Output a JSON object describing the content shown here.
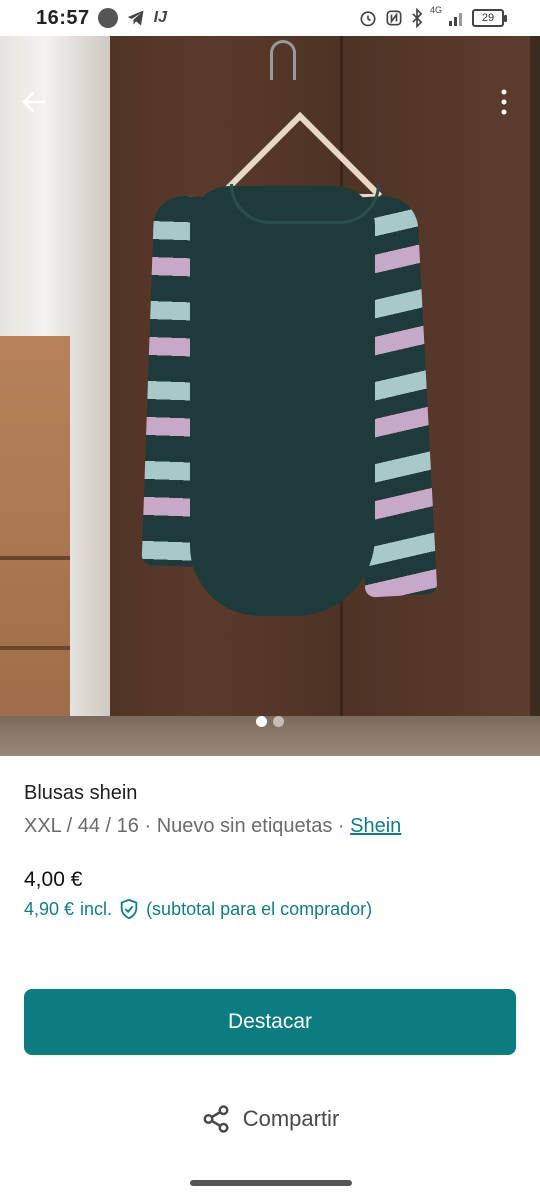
{
  "status_bar": {
    "time": "16:57",
    "network_label": "4G",
    "battery_level": "29"
  },
  "photo": {
    "current_index": 1,
    "total": 2
  },
  "item": {
    "title": "Blusas shein",
    "size": "XXL / 44 / 16",
    "condition": "Nuevo sin etiquetas",
    "brand": "Shein",
    "separator": " · ",
    "price": "4,00 €",
    "price_with_protection": "4,90 €",
    "protection_incl": "incl.",
    "protection_note": "(subtotal para el comprador)"
  },
  "actions": {
    "primary_label": "Destacar",
    "share_label": "Compartir"
  },
  "colors": {
    "accent": "#117e83",
    "primary_button": "#0b7c80"
  },
  "icons": {
    "back": "arrow-left-icon",
    "more": "more-vertical-icon",
    "shield": "shield-check-icon",
    "share": "share-icon"
  }
}
